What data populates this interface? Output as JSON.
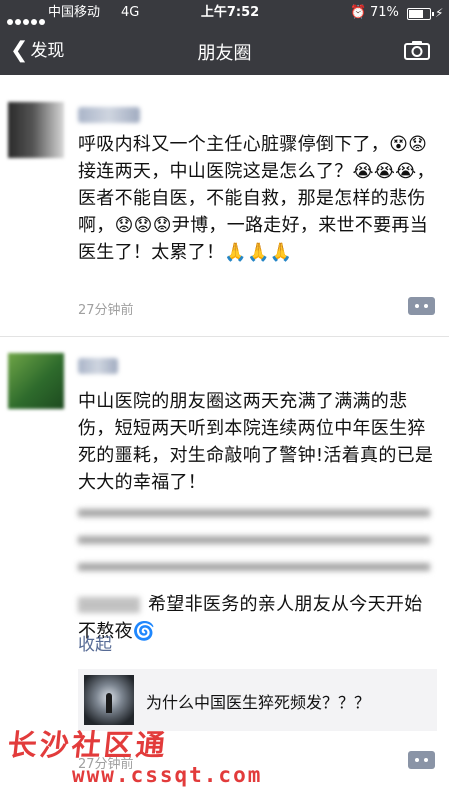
{
  "status_bar": {
    "carrier": "中国移动",
    "network": "4G",
    "time": "上午7:52",
    "battery": "71%",
    "battery_level": 0.71
  },
  "nav": {
    "back_label": "发现",
    "title": "朋友圈",
    "camera_icon": "camera-icon",
    "back_icon": "chevron-left-icon"
  },
  "posts": [
    {
      "text": "呼吸内科又一个主任心脏骤停倒下了，😵😟接连两天，中山医院这是怎么了？😭😭😭，医者不能自医，不能自救，那是怎样的悲伤啊，😟😟😟尹博，一路走好，来世不要再当医生了！太累了！🙏🙏🙏",
      "time": "27分钟前"
    },
    {
      "text_visible": "中山医院的朋友圈这两天充满了满满的悲伤，短短两天听到本院连续两位中年医生猝死的噩耗，对生命敲响了警钟!活着真的已是大大的幸福了！",
      "text_tail": "希望非医务的亲人朋友从今天开始不熬夜🌀",
      "collapse_label": "收起",
      "share_title": "为什么中国医生猝死频发？？？",
      "time": "27分钟前"
    }
  ],
  "watermark": {
    "text": "长沙社区通",
    "url": "www.cssqt.com"
  },
  "colors": {
    "nav_bg": "#393a3f",
    "link": "#576b95",
    "watermark": "#e23b3b"
  }
}
